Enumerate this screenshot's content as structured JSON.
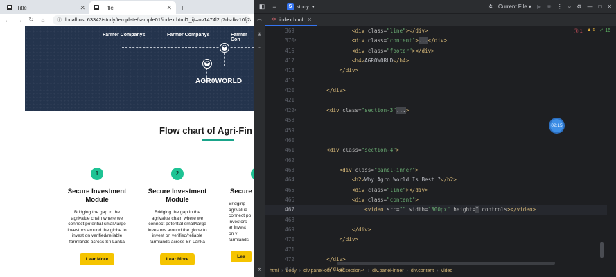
{
  "browser": {
    "tabs": [
      {
        "label": "Title",
        "close": "✕"
      },
      {
        "label": "Title",
        "close": "✕"
      }
    ],
    "new_tab": "+",
    "url": "localhost:63342/study/template/sample01/index.html?_ijt=ov1474l2q7dsdkv10fj2ao8vd1"
  },
  "page": {
    "hero": {
      "labels": [
        "Farmer Companys",
        "Farmer Companys",
        "Farmer Con"
      ],
      "plus": "+",
      "brand": "AGR0WORLD"
    },
    "flow_title": "Flow chart of Agri-Fin St",
    "cards": [
      {
        "num": "1",
        "title": "Secure Investment Module",
        "desc": "Bridging the gap in the agrivalue chain where we connect potential small/large investors around the globe to invest on verified/reliable farmlands across Sri Lanka",
        "button": "Lear More"
      },
      {
        "num": "2",
        "title": "Secure Investment Module",
        "desc": "Bridging the gap in the agrivalue chain where we connect potential small/large investors around the globe to invest on verified/reliable farmlands across Sri Lanka",
        "button": "Lear More"
      },
      {
        "num": "3",
        "title": "Secure Inv Modu",
        "desc": "Bridging agrivalue connect po investors ar invest on v farmlands",
        "button": "Lea"
      }
    ]
  },
  "ide": {
    "project_badge": "S",
    "project_name": "study",
    "run_config": "Current File",
    "file_tab": "index.html",
    "inspections": {
      "errors": "1",
      "warnings": "5",
      "ok": "16"
    },
    "timer": "02:15",
    "lines": [
      {
        "n": "369",
        "code": [
          [
            "",
            "            "
          ],
          [
            "tag",
            "<div "
          ],
          [
            "att",
            "class="
          ],
          [
            "str",
            "\"line\""
          ],
          [
            "tag",
            "></div>"
          ]
        ]
      },
      {
        "n": "370",
        "fold": "›",
        "code": [
          [
            "",
            "            "
          ],
          [
            "tag",
            "<div "
          ],
          [
            "att",
            "class="
          ],
          [
            "str",
            "\"content\""
          ],
          [
            "tag",
            ">"
          ],
          [
            "col",
            "..."
          ],
          [
            "tag",
            "</div>"
          ]
        ]
      },
      {
        "n": "416",
        "code": [
          [
            "",
            "            "
          ],
          [
            "tag",
            "<div "
          ],
          [
            "att",
            "class="
          ],
          [
            "str",
            "\"footer\""
          ],
          [
            "tag",
            "></div>"
          ]
        ]
      },
      {
        "n": "417",
        "code": [
          [
            "",
            "            "
          ],
          [
            "tag",
            "<h4>"
          ],
          [
            "txt",
            "AGROWORLD"
          ],
          [
            "tag",
            "</h4>"
          ]
        ]
      },
      {
        "n": "418",
        "code": [
          [
            "",
            "        "
          ],
          [
            "tag",
            "</div>"
          ]
        ]
      },
      {
        "n": "419",
        "code": []
      },
      {
        "n": "420",
        "code": [
          [
            "",
            "    "
          ],
          [
            "tag",
            "</div>"
          ]
        ]
      },
      {
        "n": "421",
        "code": []
      },
      {
        "n": "422",
        "fold": "›",
        "code": [
          [
            "",
            "    "
          ],
          [
            "tag",
            "<div "
          ],
          [
            "att",
            "class="
          ],
          [
            "str",
            "\"section-3\""
          ],
          [
            "col",
            "..."
          ],
          [
            "tag",
            ">"
          ]
        ]
      },
      {
        "n": "458",
        "code": []
      },
      {
        "n": "459",
        "code": []
      },
      {
        "n": "460",
        "code": []
      },
      {
        "n": "461",
        "code": [
          [
            "",
            "    "
          ],
          [
            "tag",
            "<div "
          ],
          [
            "att",
            "class="
          ],
          [
            "str",
            "\"section-4\""
          ],
          [
            "tag",
            ">"
          ]
        ]
      },
      {
        "n": "462",
        "code": []
      },
      {
        "n": "463",
        "code": [
          [
            "",
            "        "
          ],
          [
            "tag",
            "<div "
          ],
          [
            "att",
            "class="
          ],
          [
            "str",
            "\"panel-inner\""
          ],
          [
            "tag",
            ">"
          ]
        ]
      },
      {
        "n": "464",
        "code": [
          [
            "",
            "            "
          ],
          [
            "tag",
            "<h2>"
          ],
          [
            "txt",
            "Why Agro World Is Best ?"
          ],
          [
            "tag",
            "</h2>"
          ]
        ]
      },
      {
        "n": "465",
        "code": [
          [
            "",
            "            "
          ],
          [
            "tag",
            "<div "
          ],
          [
            "att",
            "class="
          ],
          [
            "str",
            "\"line\""
          ],
          [
            "tag",
            "></div>"
          ]
        ]
      },
      {
        "n": "466",
        "code": [
          [
            "",
            "            "
          ],
          [
            "tag",
            "<div "
          ],
          [
            "att",
            "class="
          ],
          [
            "str",
            "\"content\""
          ],
          [
            "tag",
            ">"
          ]
        ]
      },
      {
        "n": "467",
        "current": true,
        "code": [
          [
            "",
            "                "
          ],
          [
            "tag",
            "<video "
          ],
          [
            "att",
            "src="
          ],
          [
            "str",
            "\"\" "
          ],
          [
            "att",
            "width="
          ],
          [
            "str",
            "\"300px\" "
          ],
          [
            "att",
            "height="
          ],
          [
            "col",
            "\""
          ],
          [
            "att",
            " controls"
          ],
          [
            "tag",
            "></video>"
          ]
        ]
      },
      {
        "n": "468",
        "code": []
      },
      {
        "n": "469",
        "code": [
          [
            "",
            "            "
          ],
          [
            "tag",
            "</div>"
          ]
        ]
      },
      {
        "n": "470",
        "code": [
          [
            "",
            "        "
          ],
          [
            "tag",
            "</div>"
          ]
        ]
      },
      {
        "n": "471",
        "code": []
      },
      {
        "n": "472",
        "code": [
          [
            "",
            "    "
          ],
          [
            "tag",
            "</div>"
          ]
        ]
      },
      {
        "n": "473",
        "code": [
          [
            "",
            "    "
          ],
          [
            "tag",
            "</div>"
          ]
        ]
      }
    ],
    "breadcrumbs": [
      "html",
      "body",
      "div.panel-out",
      "div.section-4",
      "div.panel-inner",
      "div.content",
      "video"
    ]
  },
  "colors": {
    "ide_bg": "#1e1f22",
    "accent_blue": "#3574f0",
    "tag": "#d5b778",
    "string": "#6aab73",
    "hero_bg": "#24344d",
    "number_circle": "#1ec394",
    "button_yellow": "#f5c400"
  }
}
